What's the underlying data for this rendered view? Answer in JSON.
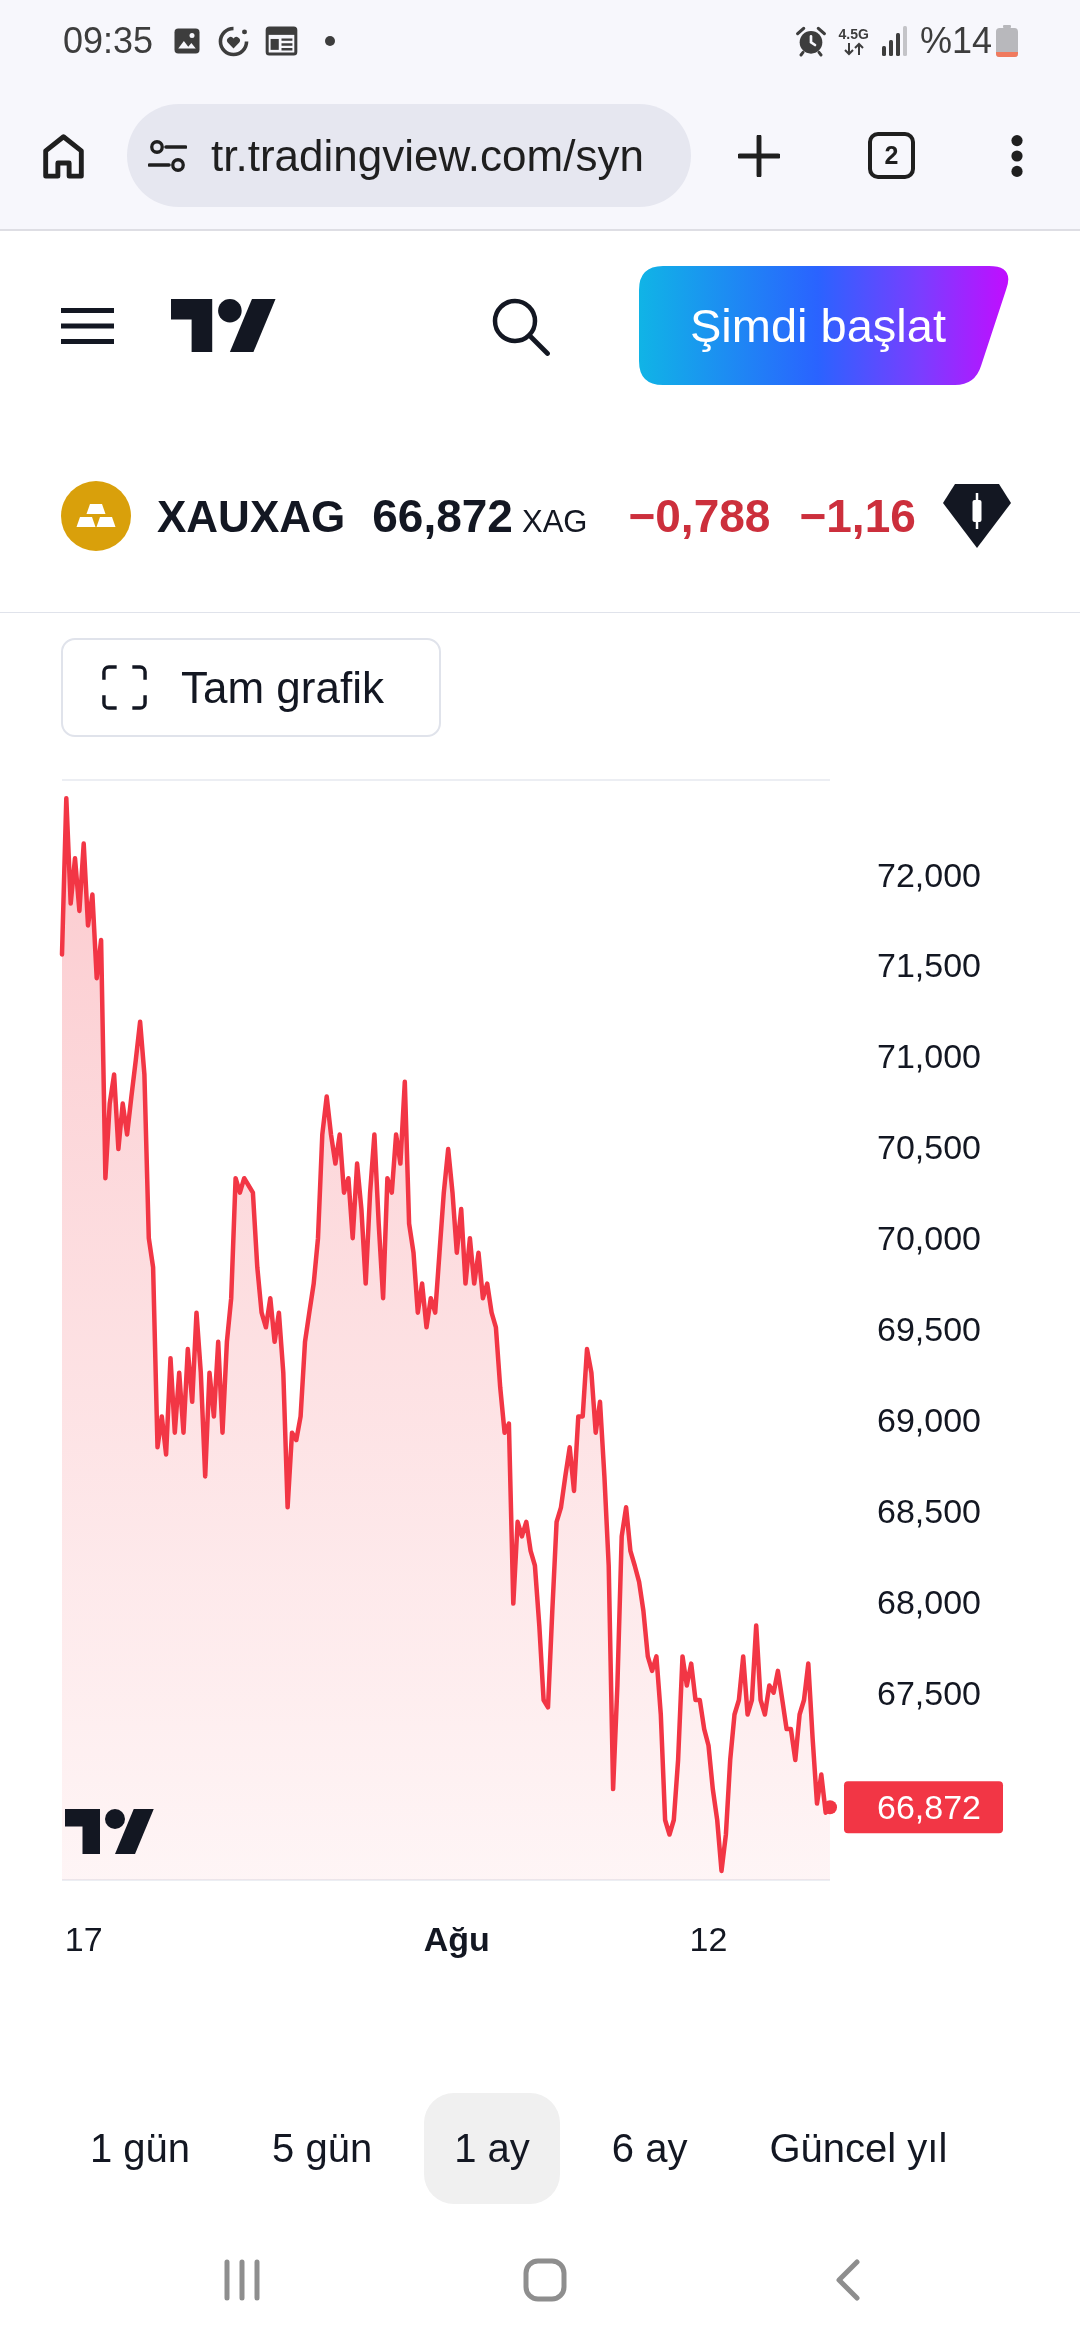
{
  "status_bar": {
    "time": "09:35",
    "network": "4.5G",
    "battery": "%14"
  },
  "browser_toolbar": {
    "url": "tr.tradingview.com/syn",
    "tab_count": "2"
  },
  "header": {
    "cta_button": "Şimdi başlat"
  },
  "ticker": {
    "symbol": "XAUXAG",
    "price": "66,872",
    "currency": "XAG",
    "change": "−0,788",
    "change_percent": "−1,16"
  },
  "full_chart_button": "Tam grafik",
  "chart": {
    "chart_data": {
      "type": "area",
      "categories": [
        null,
        null,
        null,
        null,
        null,
        "17",
        null,
        null,
        null,
        null,
        null,
        null,
        null,
        null,
        null,
        null,
        null,
        null,
        null,
        null,
        null,
        null,
        null,
        null,
        null,
        null,
        null,
        null,
        null,
        null,
        null,
        null,
        null,
        null,
        null,
        null,
        null,
        null,
        null,
        null,
        null,
        null,
        null,
        null,
        null,
        null,
        null,
        null,
        null,
        null,
        null,
        null,
        null,
        null,
        null,
        null,
        null,
        null,
        null,
        null,
        null,
        null,
        null,
        null,
        null,
        null,
        null,
        null,
        null,
        null,
        null,
        null,
        null,
        null,
        null,
        null,
        null,
        null,
        null,
        null,
        null,
        null,
        null,
        null,
        null,
        null,
        null,
        null,
        null,
        null,
        null,
        "Ağu",
        null,
        null,
        null,
        null,
        null,
        null,
        null,
        null,
        null,
        null,
        null,
        null,
        null,
        null,
        null,
        null,
        null,
        null,
        null,
        null,
        null,
        null,
        null,
        null,
        null,
        null,
        null,
        null,
        null,
        null,
        null,
        null,
        null,
        null,
        null,
        null,
        null,
        null,
        null,
        null,
        null,
        null,
        null,
        null,
        null,
        null,
        null,
        null,
        null,
        null,
        null,
        null,
        null,
        null,
        null,
        null,
        null,
        "12",
        null,
        null,
        null,
        null,
        null,
        null,
        null,
        null,
        null,
        null,
        null,
        null,
        null,
        null,
        null,
        null,
        null,
        null,
        null,
        null,
        null,
        null,
        null,
        null,
        null,
        null,
        null,
        null
      ],
      "series": [
        {
          "color": "#f23645",
          "values": [
            71.56,
            72.42,
            71.84,
            72.09,
            71.8,
            72.17,
            71.72,
            71.89,
            71.43,
            71.64,
            70.33,
            70.74,
            70.9,
            70.49,
            70.74,
            70.57,
            70.78,
            70.98,
            71.19,
            70.9,
            70.0,
            69.84,
            68.85,
            69.02,
            68.81,
            69.34,
            68.93,
            69.26,
            68.93,
            69.39,
            69.1,
            69.59,
            69.26,
            68.69,
            69.26,
            69.02,
            69.43,
            68.93,
            69.43,
            69.67,
            70.33,
            70.25,
            70.33,
            70.29,
            70.25,
            69.84,
            69.59,
            69.51,
            69.67,
            69.43,
            69.59,
            69.26,
            68.52,
            68.93,
            68.89,
            69.02,
            69.43,
            69.59,
            69.75,
            70.0,
            70.57,
            70.78,
            70.57,
            70.41,
            70.57,
            70.25,
            70.33,
            70.0,
            70.41,
            70.16,
            69.75,
            70.25,
            70.57,
            70.08,
            69.67,
            70.33,
            70.25,
            70.57,
            70.41,
            70.86,
            70.08,
            69.92,
            69.59,
            69.75,
            69.51,
            69.67,
            69.59,
            69.92,
            70.25,
            70.49,
            70.25,
            69.92,
            70.16,
            69.75,
            70.0,
            69.75,
            69.92,
            69.67,
            69.75,
            69.59,
            69.51,
            69.18,
            68.93,
            68.98,
            67.99,
            68.44,
            68.36,
            68.44,
            68.28,
            68.2,
            67.87,
            67.46,
            67.42,
            67.95,
            68.44,
            68.52,
            68.69,
            68.85,
            68.61,
            69.02,
            69.02,
            69.39,
            69.26,
            68.93,
            69.1,
            68.69,
            68.2,
            66.97,
            67.54,
            68.36,
            68.52,
            68.28,
            68.2,
            68.11,
            67.95,
            67.7,
            67.62,
            67.7,
            67.38,
            66.8,
            66.72,
            66.8,
            67.13,
            67.7,
            67.54,
            67.66,
            67.46,
            67.46,
            67.3,
            67.21,
            66.97,
            66.8,
            66.52,
            66.72,
            67.13,
            67.38,
            67.46,
            67.7,
            67.38,
            67.46,
            67.87,
            67.46,
            67.38,
            67.54,
            67.5,
            67.62,
            67.46,
            67.3,
            67.3,
            67.13,
            67.38,
            67.46,
            67.66,
            67.25,
            66.89,
            67.05,
            66.84,
            66.87
          ]
        }
      ],
      "ylim": [
        66.47,
        72.52
      ],
      "yticks": [
        {
          "value": 72,
          "label": "72,000"
        },
        {
          "value": 71.5,
          "label": "71,500"
        },
        {
          "value": 71,
          "label": "71,000"
        },
        {
          "value": 70.5,
          "label": "70,500"
        },
        {
          "value": 70,
          "label": "70,000"
        },
        {
          "value": 69.5,
          "label": "69,500"
        },
        {
          "value": 69,
          "label": "69,000"
        },
        {
          "value": 68.5,
          "label": "68,500"
        },
        {
          "value": 68,
          "label": "68,000"
        },
        {
          "value": 67.5,
          "label": "67,500"
        }
      ]
    },
    "x_label_bold": [
      false,
      true,
      false
    ],
    "price_tag": "66,872"
  },
  "range_tabs": [
    {
      "label": "1 gün",
      "selected": false
    },
    {
      "label": "5 gün",
      "selected": false
    },
    {
      "label": "1 ay",
      "selected": true
    },
    {
      "label": "6 ay",
      "selected": false
    },
    {
      "label": "Güncel yıl",
      "selected": false
    }
  ]
}
